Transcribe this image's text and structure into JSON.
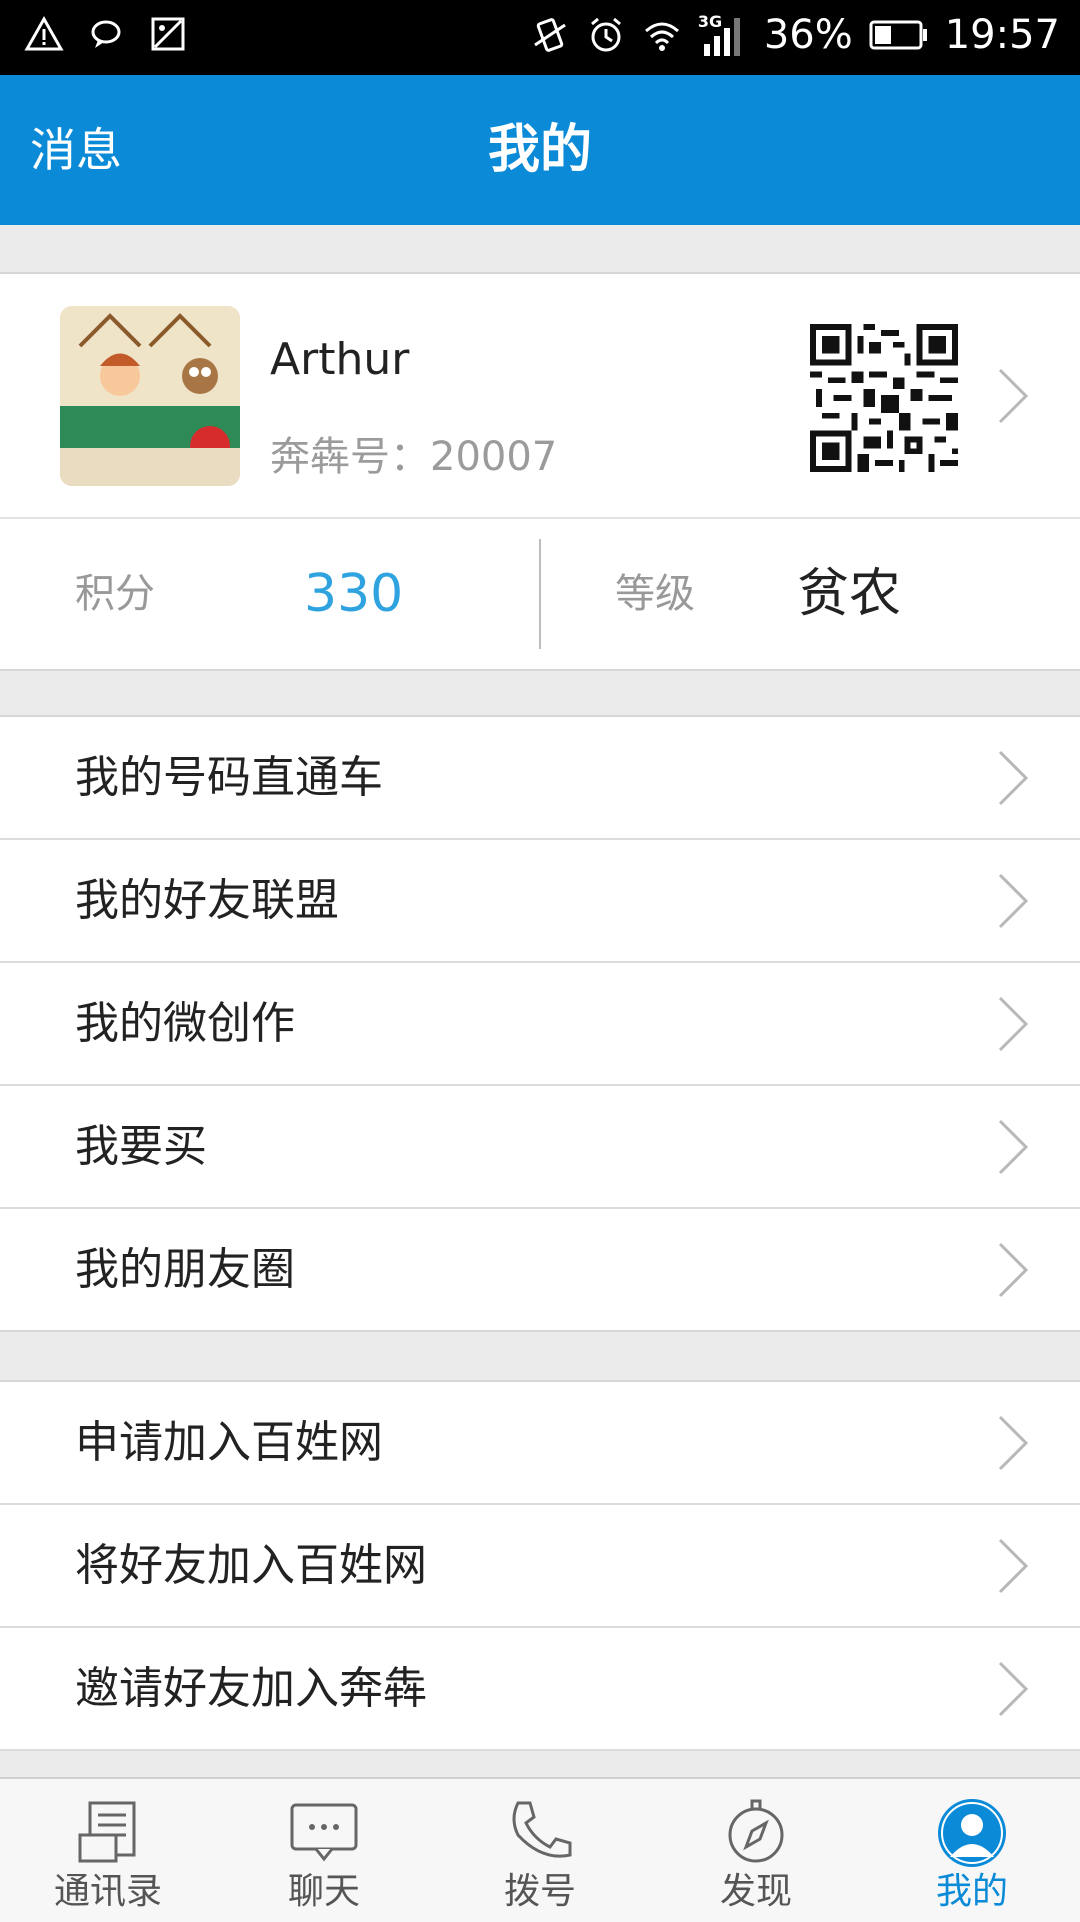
{
  "status_bar": {
    "battery": "36%",
    "time": "19:57",
    "network": "3G"
  },
  "header": {
    "left_label": "消息",
    "title": "我的"
  },
  "profile": {
    "name": "Arthur",
    "id_label": "奔犇号：",
    "id_value": "20007"
  },
  "stats": {
    "points_label": "积分",
    "points_value": "330",
    "level_label": "等级",
    "level_value": "贫农"
  },
  "menu_group_1": [
    {
      "label": "我的号码直通车"
    },
    {
      "label": "我的好友联盟"
    },
    {
      "label": "我的微创作"
    },
    {
      "label": "我要买"
    },
    {
      "label": "我的朋友圈"
    }
  ],
  "menu_group_2": [
    {
      "label": "申请加入百姓网"
    },
    {
      "label": "将好友加入百姓网"
    },
    {
      "label": "邀请好友加入奔犇"
    }
  ],
  "tabs": [
    {
      "label": "通讯录",
      "icon": "contacts-icon"
    },
    {
      "label": "聊天",
      "icon": "chat-icon"
    },
    {
      "label": "拨号",
      "icon": "phone-icon"
    },
    {
      "label": "发现",
      "icon": "compass-icon"
    },
    {
      "label": "我的",
      "icon": "user-icon"
    }
  ],
  "colors": {
    "accent": "#0b8bd7",
    "points": "#2fa3e0"
  }
}
